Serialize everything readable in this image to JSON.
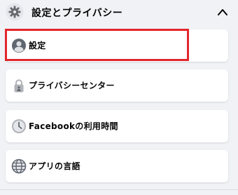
{
  "header": {
    "title": "設定とプライバシー",
    "icon": "gear-icon",
    "expand_icon": "chevron-up-icon"
  },
  "items": [
    {
      "label": "設定",
      "icon": "user-circle-icon"
    },
    {
      "label": "プライバシーセンター",
      "icon": "lock-icon"
    },
    {
      "label": "Facebookの利用時間",
      "icon": "clock-icon"
    },
    {
      "label": "アプリの言語",
      "icon": "globe-icon"
    }
  ],
  "colors": {
    "highlight": "#e2262c",
    "background": "#f0f2f5",
    "card": "#ffffff"
  }
}
